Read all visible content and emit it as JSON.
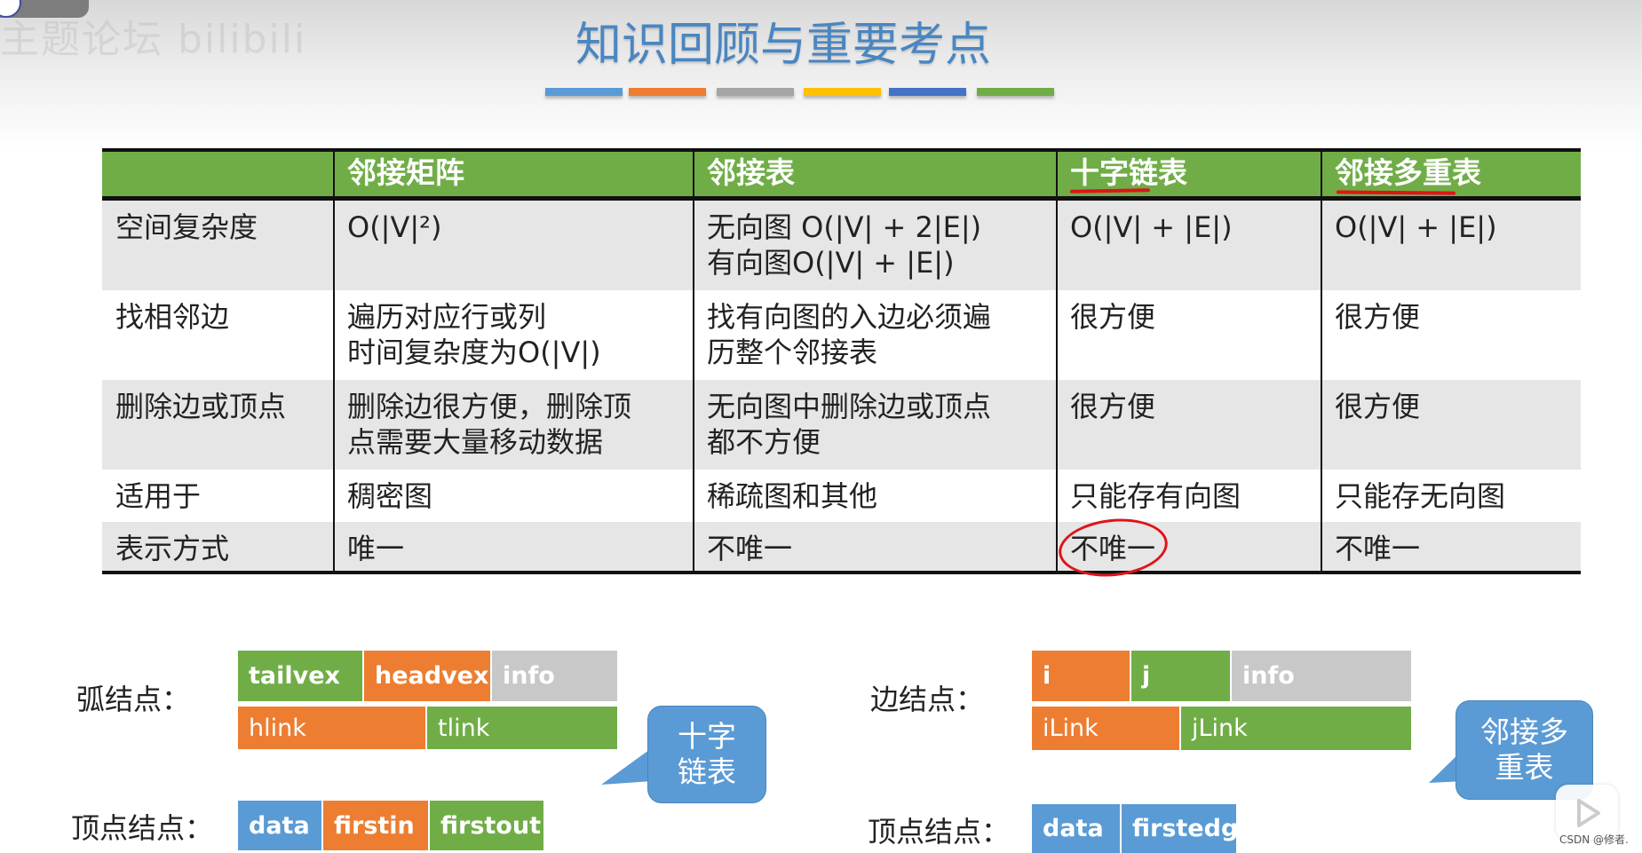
{
  "title": "知识回顾与重要考点",
  "watermark": "主题论坛 bilibili",
  "color_bars": [
    "#5b9bd5",
    "#ed7d31",
    "#a5a5a5",
    "#ffc000",
    "#4472c4",
    "#70ad47"
  ],
  "table": {
    "headers": [
      "",
      "邻接矩阵",
      "邻接表",
      "十字链表",
      "邻接多重表"
    ],
    "rows": [
      {
        "label": "空间复杂度",
        "cells": [
          "O(|V|²)",
          "无向图 O(|V| + 2|E|)\n有向图O(|V| + |E|)",
          "O(|V| + |E|)",
          "O(|V| + |E|)"
        ]
      },
      {
        "label": "找相邻边",
        "cells": [
          "遍历对应行或列\n时间复杂度为O(|V|)",
          "找有向图的入边必须遍\n历整个邻接表",
          "很方便",
          "很方便"
        ]
      },
      {
        "label": "删除边或顶点",
        "cells": [
          "删除边很方便，删除顶\n点需要大量移动数据",
          "无向图中删除边或顶点\n都不方便",
          "很方便",
          "很方便"
        ]
      },
      {
        "label": "适用于",
        "cells": [
          "稠密图",
          "稀疏图和其他",
          "只能存有向图",
          "只能存无向图"
        ]
      },
      {
        "label": "表示方式",
        "cells": [
          "唯一",
          "不唯一",
          "不唯一",
          "不唯一"
        ]
      }
    ],
    "annotations": {
      "underlined_headers": [
        "十字链表",
        "邻接多重表"
      ],
      "circled_cell": "不唯一"
    }
  },
  "orthogonal_list": {
    "arc_node_label": "弧结点：",
    "arc_node_row1": [
      "tailvex",
      "headvex",
      "info"
    ],
    "arc_node_row2": [
      "hlink",
      "tlink"
    ],
    "vertex_node_label": "顶点结点：",
    "vertex_node": [
      "data",
      "firstin",
      "firstout"
    ],
    "callout": "十字\n链表"
  },
  "adjacency_multilist": {
    "edge_node_label": "边结点：",
    "edge_node_row1": [
      "i",
      "j",
      "info"
    ],
    "edge_node_row2": [
      "iLink",
      "jLink"
    ],
    "vertex_node_label": "顶点结点：",
    "vertex_node": [
      "data",
      "firstedge"
    ],
    "callout": "邻接多\n重表"
  },
  "footer_watermark": "CSDN @修者."
}
